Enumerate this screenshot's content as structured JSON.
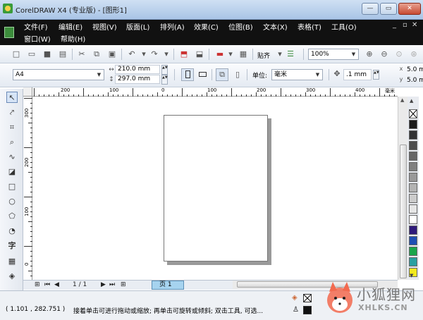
{
  "window": {
    "title": "CorelDRAW X4 (专业版) - [图形1]",
    "min": "—",
    "max": "▭",
    "close": "✕"
  },
  "menu": {
    "row1": [
      "文件(F)",
      "编辑(E)",
      "视图(V)",
      "版面(L)",
      "排列(A)",
      "效果(C)",
      "位图(B)",
      "文本(X)",
      "表格(T)",
      "工具(O)"
    ],
    "row2": [
      "窗口(W)",
      "帮助(H)"
    ],
    "mdi": {
      "min": "_",
      "restore": "▫",
      "close": "✕"
    }
  },
  "standard_toolbar": {
    "paste_label": "贴齐",
    "zoom_value": "100%"
  },
  "property_bar": {
    "paper_size": "A4",
    "width": "210.0 mm",
    "height": "297.0 mm",
    "units_label": "单位:",
    "units_value": "毫米",
    "nudge_value": ".1 mm",
    "dup_x": "5.0 m",
    "dup_y": "5.0 m"
  },
  "ruler": {
    "unit": "毫米",
    "h_labels": [
      "200",
      "100",
      "0",
      "100",
      "200",
      "300",
      "400"
    ],
    "v_labels": [
      "300",
      "200",
      "100",
      "0"
    ]
  },
  "page_nav": {
    "page_count": "1 / 1",
    "page_tab": "页 1"
  },
  "palette": {
    "colors": [
      "#ffffff",
      "#1a1a1a",
      "#333333",
      "#4d4d4d",
      "#666666",
      "#808080",
      "#999999",
      "#b3b3b3",
      "#cccccc",
      "#e6e6e6",
      "#ffffff",
      "#2e1a7a",
      "#1f4fb3",
      "#1aa54a",
      "#2aa0a0",
      "#f2ea1e"
    ]
  },
  "status": {
    "coords": "( 1.101 , 282.751 )",
    "hint": "接着单击可进行拖动或缩放; 再单击可旋转或倾斜; 双击工具, 可选..."
  },
  "watermark": {
    "text": "小狐狸网",
    "sub": "XHLKS.CN"
  }
}
